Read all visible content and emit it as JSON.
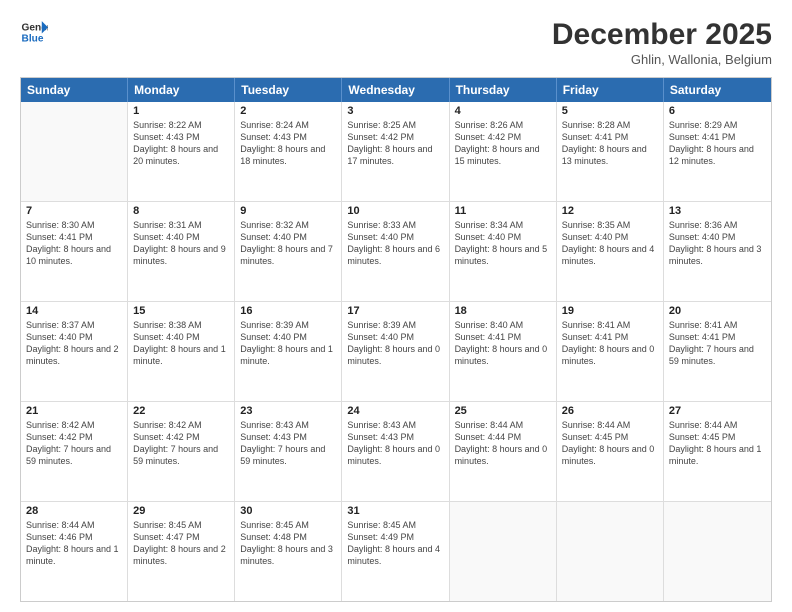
{
  "logo": {
    "line1": "General",
    "line2": "Blue"
  },
  "title": "December 2025",
  "subtitle": "Ghlin, Wallonia, Belgium",
  "days_of_week": [
    "Sunday",
    "Monday",
    "Tuesday",
    "Wednesday",
    "Thursday",
    "Friday",
    "Saturday"
  ],
  "weeks": [
    [
      {
        "day": "",
        "empty": true
      },
      {
        "day": "1",
        "sunrise": "8:22 AM",
        "sunset": "4:43 PM",
        "daylight": "8 hours and 20 minutes."
      },
      {
        "day": "2",
        "sunrise": "8:24 AM",
        "sunset": "4:43 PM",
        "daylight": "8 hours and 18 minutes."
      },
      {
        "day": "3",
        "sunrise": "8:25 AM",
        "sunset": "4:42 PM",
        "daylight": "8 hours and 17 minutes."
      },
      {
        "day": "4",
        "sunrise": "8:26 AM",
        "sunset": "4:42 PM",
        "daylight": "8 hours and 15 minutes."
      },
      {
        "day": "5",
        "sunrise": "8:28 AM",
        "sunset": "4:41 PM",
        "daylight": "8 hours and 13 minutes."
      },
      {
        "day": "6",
        "sunrise": "8:29 AM",
        "sunset": "4:41 PM",
        "daylight": "8 hours and 12 minutes."
      }
    ],
    [
      {
        "day": "7",
        "sunrise": "8:30 AM",
        "sunset": "4:41 PM",
        "daylight": "8 hours and 10 minutes."
      },
      {
        "day": "8",
        "sunrise": "8:31 AM",
        "sunset": "4:40 PM",
        "daylight": "8 hours and 9 minutes."
      },
      {
        "day": "9",
        "sunrise": "8:32 AM",
        "sunset": "4:40 PM",
        "daylight": "8 hours and 7 minutes."
      },
      {
        "day": "10",
        "sunrise": "8:33 AM",
        "sunset": "4:40 PM",
        "daylight": "8 hours and 6 minutes."
      },
      {
        "day": "11",
        "sunrise": "8:34 AM",
        "sunset": "4:40 PM",
        "daylight": "8 hours and 5 minutes."
      },
      {
        "day": "12",
        "sunrise": "8:35 AM",
        "sunset": "4:40 PM",
        "daylight": "8 hours and 4 minutes."
      },
      {
        "day": "13",
        "sunrise": "8:36 AM",
        "sunset": "4:40 PM",
        "daylight": "8 hours and 3 minutes."
      }
    ],
    [
      {
        "day": "14",
        "sunrise": "8:37 AM",
        "sunset": "4:40 PM",
        "daylight": "8 hours and 2 minutes."
      },
      {
        "day": "15",
        "sunrise": "8:38 AM",
        "sunset": "4:40 PM",
        "daylight": "8 hours and 1 minute."
      },
      {
        "day": "16",
        "sunrise": "8:39 AM",
        "sunset": "4:40 PM",
        "daylight": "8 hours and 1 minute."
      },
      {
        "day": "17",
        "sunrise": "8:39 AM",
        "sunset": "4:40 PM",
        "daylight": "8 hours and 0 minutes."
      },
      {
        "day": "18",
        "sunrise": "8:40 AM",
        "sunset": "4:41 PM",
        "daylight": "8 hours and 0 minutes."
      },
      {
        "day": "19",
        "sunrise": "8:41 AM",
        "sunset": "4:41 PM",
        "daylight": "8 hours and 0 minutes."
      },
      {
        "day": "20",
        "sunrise": "8:41 AM",
        "sunset": "4:41 PM",
        "daylight": "7 hours and 59 minutes."
      }
    ],
    [
      {
        "day": "21",
        "sunrise": "8:42 AM",
        "sunset": "4:42 PM",
        "daylight": "7 hours and 59 minutes."
      },
      {
        "day": "22",
        "sunrise": "8:42 AM",
        "sunset": "4:42 PM",
        "daylight": "7 hours and 59 minutes."
      },
      {
        "day": "23",
        "sunrise": "8:43 AM",
        "sunset": "4:43 PM",
        "daylight": "7 hours and 59 minutes."
      },
      {
        "day": "24",
        "sunrise": "8:43 AM",
        "sunset": "4:43 PM",
        "daylight": "8 hours and 0 minutes."
      },
      {
        "day": "25",
        "sunrise": "8:44 AM",
        "sunset": "4:44 PM",
        "daylight": "8 hours and 0 minutes."
      },
      {
        "day": "26",
        "sunrise": "8:44 AM",
        "sunset": "4:45 PM",
        "daylight": "8 hours and 0 minutes."
      },
      {
        "day": "27",
        "sunrise": "8:44 AM",
        "sunset": "4:45 PM",
        "daylight": "8 hours and 1 minute."
      }
    ],
    [
      {
        "day": "28",
        "sunrise": "8:44 AM",
        "sunset": "4:46 PM",
        "daylight": "8 hours and 1 minute."
      },
      {
        "day": "29",
        "sunrise": "8:45 AM",
        "sunset": "4:47 PM",
        "daylight": "8 hours and 2 minutes."
      },
      {
        "day": "30",
        "sunrise": "8:45 AM",
        "sunset": "4:48 PM",
        "daylight": "8 hours and 3 minutes."
      },
      {
        "day": "31",
        "sunrise": "8:45 AM",
        "sunset": "4:49 PM",
        "daylight": "8 hours and 4 minutes."
      },
      {
        "day": "",
        "empty": true
      },
      {
        "day": "",
        "empty": true
      },
      {
        "day": "",
        "empty": true
      }
    ]
  ]
}
